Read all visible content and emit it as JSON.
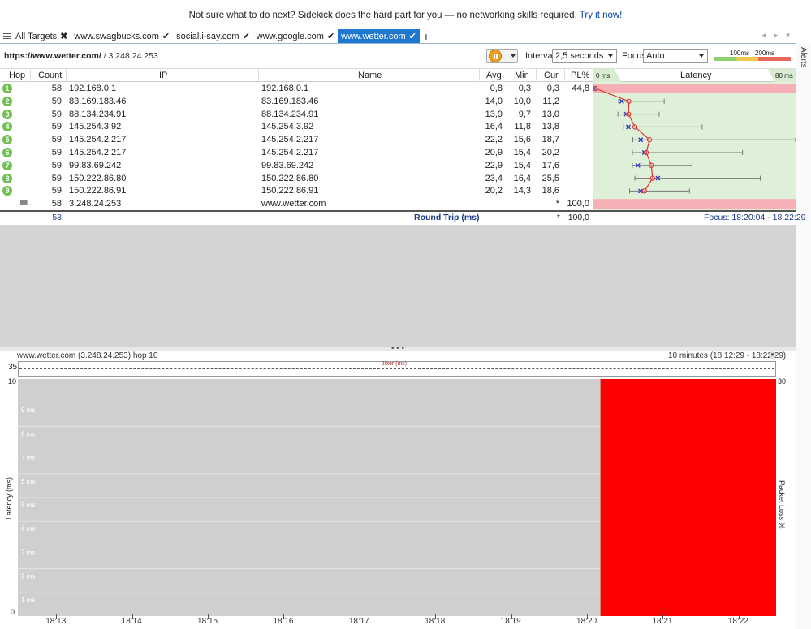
{
  "banner": {
    "text": "Not sure what to do next? Sidekick does the hard part for you — no networking skills required.",
    "link": "Try it now!"
  },
  "tabs": [
    {
      "label": "All Targets",
      "mark": "✖",
      "active": false
    },
    {
      "label": "www.swagbucks.com",
      "mark": "✔",
      "active": false
    },
    {
      "label": "social.i-say.com",
      "mark": "✔",
      "active": false
    },
    {
      "label": "www.google.com",
      "mark": "✔",
      "active": false
    },
    {
      "label": "www.wetter.com",
      "mark": "✔",
      "active": true
    }
  ],
  "tab_add": "+",
  "tab_nav": "◂ ▸ ▾",
  "alerts_label": "Alerts",
  "toolbar": {
    "url_host": "https://www.wetter.com/",
    "url_ip": " / 3.248.24.253",
    "interval_label": "Interval",
    "interval_value": "2,5 seconds",
    "focus_label": "Focus",
    "focus_value": "Auto",
    "legend_100": "100ms",
    "legend_200": "200ms"
  },
  "table": {
    "columns": {
      "hop": "Hop",
      "count": "Count",
      "ip": "IP",
      "name": "Name",
      "avg": "Avg",
      "min": "Min",
      "cur": "Cur",
      "pl": "PL%",
      "lat_min": "0 ms",
      "latency": "Latency",
      "lat_max": "80 ms"
    },
    "rows": [
      {
        "hop": "1",
        "count": "58",
        "ip": "192.168.0.1",
        "name": "192.168.0.1",
        "avg": "0,8",
        "min": "0,3",
        "cur": "0,3",
        "pl": "44,8",
        "avgv": 0.8,
        "minv": 0.3,
        "curv": 0.3,
        "maxv": 0.9,
        "loss": true
      },
      {
        "hop": "2",
        "count": "59",
        "ip": "83.169.183.46",
        "name": "83.169.183.46",
        "avg": "14,0",
        "min": "10,0",
        "cur": "11,2",
        "pl": "",
        "avgv": 14.0,
        "minv": 10.0,
        "curv": 11.2,
        "maxv": 28,
        "loss": false
      },
      {
        "hop": "3",
        "count": "59",
        "ip": "88.134.234.91",
        "name": "88.134.234.91",
        "avg": "13,9",
        "min": "9,7",
        "cur": "13,0",
        "pl": "",
        "avgv": 13.9,
        "minv": 9.7,
        "curv": 13.0,
        "maxv": 26,
        "loss": false
      },
      {
        "hop": "4",
        "count": "59",
        "ip": "145.254.3.92",
        "name": "145.254.3.92",
        "avg": "16,4",
        "min": "11,8",
        "cur": "13,8",
        "pl": "",
        "avgv": 16.4,
        "minv": 11.8,
        "curv": 13.8,
        "maxv": 43,
        "loss": false
      },
      {
        "hop": "5",
        "count": "59",
        "ip": "145.254.2.217",
        "name": "145.254.2.217",
        "avg": "22,2",
        "min": "15,6",
        "cur": "18,7",
        "pl": "",
        "avgv": 22.2,
        "minv": 15.6,
        "curv": 18.7,
        "maxv": 80,
        "loss": false
      },
      {
        "hop": "6",
        "count": "59",
        "ip": "145.254.2.217",
        "name": "145.254.2.217",
        "avg": "20,9",
        "min": "15,4",
        "cur": "20,2",
        "pl": "",
        "avgv": 20.9,
        "minv": 15.4,
        "curv": 20.2,
        "maxv": 59,
        "loss": false
      },
      {
        "hop": "7",
        "count": "59",
        "ip": "99.83.69.242",
        "name": "99.83.69.242",
        "avg": "22,9",
        "min": "15,4",
        "cur": "17,6",
        "pl": "",
        "avgv": 22.9,
        "minv": 15.4,
        "curv": 17.6,
        "maxv": 39,
        "loss": false
      },
      {
        "hop": "8",
        "count": "59",
        "ip": "150.222.86.80",
        "name": "150.222.86.80",
        "avg": "23,4",
        "min": "16,4",
        "cur": "25,5",
        "pl": "",
        "avgv": 23.4,
        "minv": 16.4,
        "curv": 25.5,
        "maxv": 66,
        "loss": false
      },
      {
        "hop": "9",
        "count": "59",
        "ip": "150.222.86.91",
        "name": "150.222.86.91",
        "avg": "20,2",
        "min": "14,3",
        "cur": "18,6",
        "pl": "",
        "avgv": 20.2,
        "minv": 14.3,
        "curv": 18.6,
        "maxv": 38,
        "loss": false
      },
      {
        "hop": "",
        "count": "58",
        "ip": "3.248.24.253",
        "name": "www.wetter.com",
        "avg": "",
        "min": "",
        "cur": "*",
        "pl": "100,0",
        "avgv": null,
        "minv": null,
        "curv": null,
        "maxv": null,
        "loss": true
      }
    ],
    "round_trip": {
      "count": "58",
      "label": "Round Trip (ms)",
      "cur": "*",
      "pl": "100,0",
      "focus": "Focus: 18:20:04 - 18:22:29"
    }
  },
  "splitter_dots": "• • •",
  "bottom": {
    "target": "www.wetter.com (3.248.24.253) hop 10",
    "range": "10 minutes (18:12:29 - 18:22:29)",
    "jitter_label": "Jitter (ms)",
    "jitter_max": "35"
  },
  "chart_data": {
    "type": "area",
    "ylabel": "Latency (ms)",
    "y2label": "Packet Loss %",
    "ylim": [
      0,
      10
    ],
    "y2_max_label": "30",
    "yticks": [
      "10",
      "9 ms",
      "8 ms",
      "7 ms",
      "6 ms",
      "5 ms",
      "4 ms",
      "3 ms",
      "2 ms",
      "1 ms",
      "0"
    ],
    "x_ticks": [
      "18:13",
      "18:14",
      "18:15",
      "18:16",
      "18:17",
      "18:18",
      "18:19",
      "18:20",
      "18:21",
      "18:22"
    ],
    "xlim": [
      "18:12:29",
      "18:22:29"
    ],
    "series": [
      {
        "name": "Packet Loss %",
        "segments": [
          {
            "start": "18:20:10",
            "end": "18:22:29",
            "value": 100
          }
        ]
      }
    ],
    "colors": {
      "loss": "#ff0000",
      "background": "#cfcfcf"
    }
  }
}
